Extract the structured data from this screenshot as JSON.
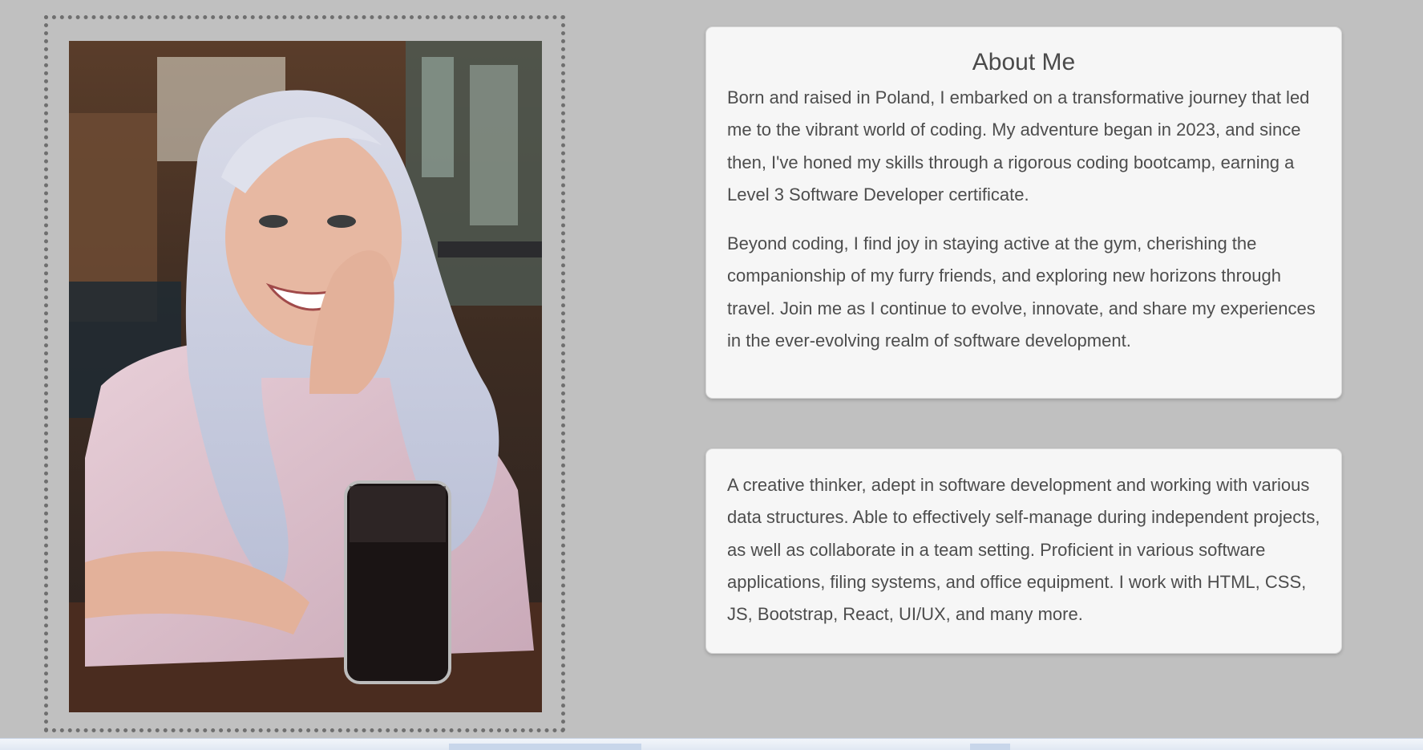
{
  "photo": {
    "alt": "Portrait photo"
  },
  "about": {
    "title": "About Me",
    "paragraphs": [
      "Born and raised in Poland, I embarked on a transformative journey that led me to the vibrant world of coding. My adventure began in 2023, and since then, I've honed my skills through a rigorous coding bootcamp, earning a Level 3 Software Developer certificate.",
      "Beyond coding, I find joy in staying active at the gym, cherishing the companionship of my furry friends, and exploring new horizons through travel. Join me as I continue to evolve, innovate, and share my experiences in the ever-evolving realm of software development."
    ]
  },
  "skills": {
    "text": "A creative thinker, adept in software development and working with various data structures. Able to effectively self-manage during independent projects, as well as collaborate in a team setting. Proficient in various software applications, filing systems, and office equipment. I work with HTML, CSS, JS, Bootstrap, React, UI/UX, and many more."
  },
  "colors": {
    "page_background": "#c0c0c0",
    "card_background": "#f6f6f6",
    "text": "#4d4d4d",
    "frame_border": "#6f6f6f"
  }
}
